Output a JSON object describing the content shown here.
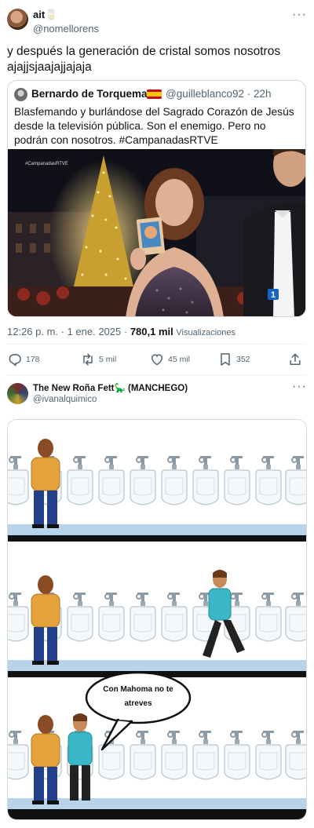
{
  "tweet1": {
    "author_name": "ait🥛",
    "author_handle": "@nomellorens",
    "text": "y después la generación de cristal somos nosotros ajajjsjaajajjajaja",
    "quote": {
      "author_name": "Bernardo de Torquemada",
      "author_handle": "@guilleblanco92 · 22h",
      "text": "Blasfemando y burlándose del Sagrado Corazón de Jesús desde la televisión pública. Son el enemigo. Pero no podrán con nosotros. #CampanadasRTVE",
      "media_watermark": "#CampanadasRTVE",
      "channel_logo": "1"
    },
    "timestamp": "12:26 p. m. · 1 ene. 2025 · ",
    "views_count": "780,1 mil",
    "views_label": "Visualizaciones",
    "stats": {
      "replies": "178",
      "retweets": "5 mil",
      "likes": "45 mil",
      "bookmarks": "352"
    }
  },
  "tweet2": {
    "author_name": "The New Roña Fett🦕 (MANCHEGO)",
    "author_handle": "@ivanalquimico",
    "comic": {
      "speech_line1": "Con Mahoma no te",
      "speech_line2": "atreves"
    }
  },
  "more_icon": "···"
}
